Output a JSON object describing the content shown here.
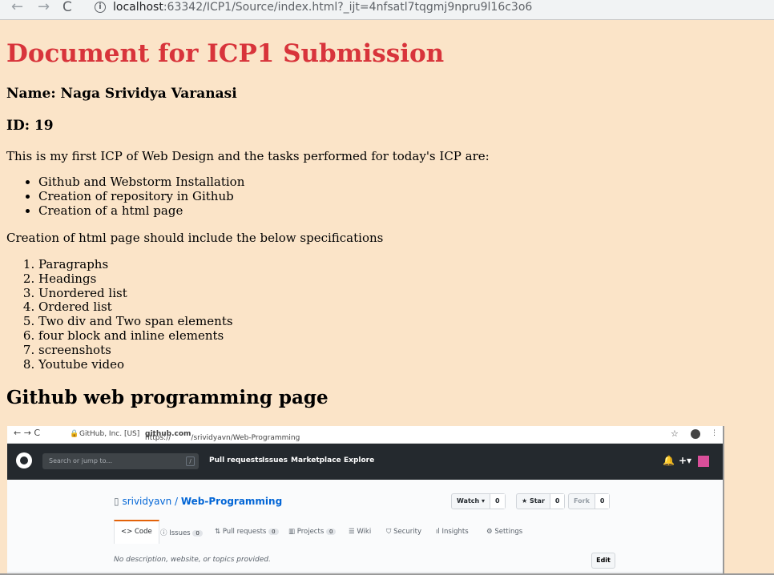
{
  "browser": {
    "back_glyph": "←",
    "forward_glyph": "→",
    "reload_glyph": "C",
    "url_host": "localhost",
    "url_rest": ":63342/ICP1/Source/index.html?_ijt=4nfsatl7tqgmj9npru9l16c3o6"
  },
  "page": {
    "title": "Document for ICP1 Submission",
    "name_line": "Name: Naga Srividya Varanasi",
    "id_line": "ID: 19",
    "intro": "This is my first ICP of Web Design and the tasks performed for today's ICP are:",
    "tasks": [
      "Github and Webstorm Installation",
      "Creation of repository in Github",
      "Creation of a html page"
    ],
    "spec_intro": "Creation of html page should include the below specifications",
    "specs": [
      "Paragraphs",
      "Headings",
      "Unordered list",
      "Ordered list",
      "Two div and Two span elements",
      "four block and inline elements",
      "screenshots",
      "Youtube video"
    ],
    "section_heading": "Github web programming page"
  },
  "screenshot": {
    "addr_site": "GitHub, Inc. [US]",
    "addr_url_prefix": "https://",
    "addr_url_host": "github.com",
    "addr_url_path": "/srividyavn/Web-Programming",
    "search_placeholder": "Search or jump to...",
    "slash": "/",
    "nav_links": [
      "Pull requests",
      "Issues",
      "Marketplace",
      "Explore"
    ],
    "owner": "srividyavn",
    "separator": " / ",
    "repo": "Web-Programming",
    "watch_label": "Watch ▾",
    "watch_count": "0",
    "star_label": "★ Star",
    "star_count": "0",
    "fork_label": "Fork",
    "fork_count": "0",
    "tabs": [
      {
        "label": "<> Code",
        "count": ""
      },
      {
        "label": "Issues",
        "count": "0"
      },
      {
        "label": "Pull requests",
        "count": "0"
      },
      {
        "label": "Projects",
        "count": "0"
      },
      {
        "label": "Wiki",
        "count": ""
      },
      {
        "label": "Security",
        "count": ""
      },
      {
        "label": "Insights",
        "count": ""
      },
      {
        "label": "Settings",
        "count": ""
      }
    ],
    "description": "No description, website, or topics provided.",
    "edit_label": "Edit"
  }
}
